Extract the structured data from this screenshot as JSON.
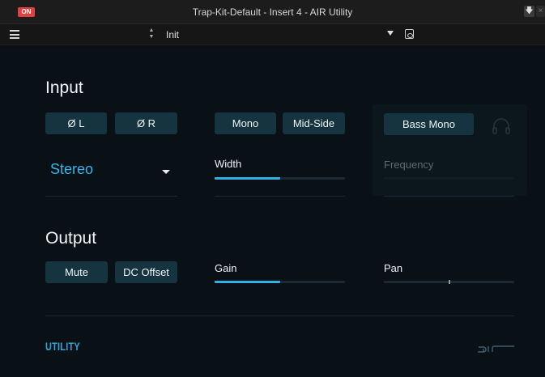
{
  "window": {
    "on_label": "ON",
    "title": "Trap-Kit-Default - Insert 4 - AIR Utility",
    "download_icon": "down-arrow",
    "close_icon": "x"
  },
  "preset": {
    "stepper_up": "▲",
    "stepper_down": "▼",
    "name": "Init"
  },
  "input": {
    "title": "Input",
    "phase_left": "Ø L",
    "phase_right": "Ø R",
    "mono": "Mono",
    "mid_side": "Mid-Side",
    "bass_mono": "Bass Mono",
    "stereo_mode": "Stereo",
    "width_label": "Width",
    "width_value": 0.5,
    "frequency_label": "Frequency"
  },
  "output": {
    "title": "Output",
    "mute": "Mute",
    "dc_offset": "DC Offset",
    "gain_label": "Gain",
    "gain_value": 0.5,
    "pan_label": "Pan",
    "pan_value": 0.5
  },
  "footer": {
    "utility_label": "UTILITY"
  },
  "colors": {
    "accent": "#2fb2e2",
    "button_bg": "#16343f",
    "on_red": "#e04040"
  }
}
